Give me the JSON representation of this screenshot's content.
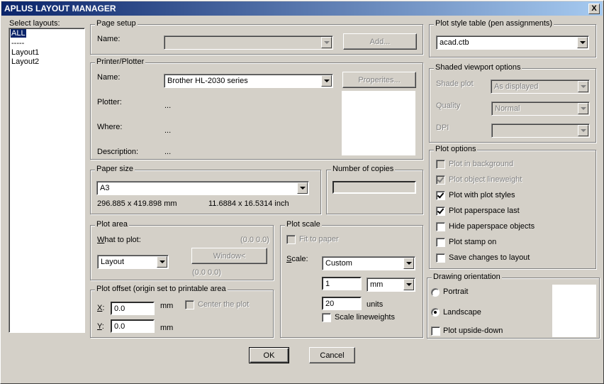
{
  "window": {
    "title": "APLUS LAYOUT MANAGER",
    "close": "X"
  },
  "layouts": {
    "label": "Select layouts:",
    "items": [
      "ALL",
      "-----",
      "Layout1",
      "Layout2"
    ],
    "selected": "ALL"
  },
  "page_setup": {
    "title": "Page setup",
    "name_label": "Name:",
    "name_value": "",
    "add_button": "Add..."
  },
  "printer": {
    "title": "Printer/Plotter",
    "name_label": "Name:",
    "name_value": "Brother HL-2030 series",
    "properties_button": "Properites...",
    "plotter_label": "Plotter:",
    "plotter_value": "...",
    "where_label": "Where:",
    "where_value": "...",
    "description_label": "Description:",
    "description_value": "..."
  },
  "paper": {
    "title": "Paper size",
    "value": "A3",
    "mm": "296.885 x 419.898 mm",
    "inch": "11.6884 x 16.5314 inch"
  },
  "copies": {
    "title": "Number of copies",
    "value": ""
  },
  "plot_area": {
    "title": "Plot area",
    "what_label": "What to plot:",
    "coord_top": "(0.0 0.0)",
    "value": "Layout",
    "window_button": "Window<",
    "coord_bottom": "(0.0 0.0)"
  },
  "plot_offset": {
    "title": "Plot offset (origin set to printable area",
    "x_label": "X:",
    "x_value": "0.0",
    "x_unit": "mm",
    "y_label": "Y:",
    "y_value": "0.0",
    "y_unit": "mm",
    "center": "Center the plot",
    "center_checked": false
  },
  "plot_scale": {
    "title": "Plot scale",
    "fit": "Fit to paper",
    "fit_checked": false,
    "scale_label": "Scale:",
    "scale_value": "Custom",
    "num_value": "1",
    "unit_value": "mm",
    "den_value": "20",
    "den_unit": "units",
    "lineweights": "Scale lineweights",
    "lineweights_checked": false
  },
  "plot_style": {
    "title": "Plot style table (pen assignments)",
    "value": "acad.ctb"
  },
  "shaded": {
    "title": "Shaded viewport options",
    "shade_label": "Shade plot",
    "shade_value": "As displayed",
    "quality_label": "Quality",
    "quality_value": "Normal",
    "dpi_label": "DPI",
    "dpi_value": ""
  },
  "plot_options": {
    "title": "Plot options",
    "items": [
      {
        "label": "Plot in background",
        "checked": false,
        "enabled": false
      },
      {
        "label": "Plot object lineweight",
        "checked": true,
        "enabled": false
      },
      {
        "label": "Plot with plot styles",
        "checked": true,
        "enabled": true
      },
      {
        "label": "Plot paperspace last",
        "checked": true,
        "enabled": true
      },
      {
        "label": "Hide paperspace objects",
        "checked": false,
        "enabled": true
      },
      {
        "label": "Plot stamp on",
        "checked": false,
        "enabled": true
      },
      {
        "label": "Save changes to layout",
        "checked": false,
        "enabled": true
      }
    ]
  },
  "orientation": {
    "title": "Drawing orientation",
    "portrait": "Portrait",
    "landscape": "Landscape",
    "selected": "Landscape",
    "upside": "Plot upside-down",
    "upside_checked": false
  },
  "footer": {
    "ok": "OK",
    "cancel": "Cancel"
  }
}
